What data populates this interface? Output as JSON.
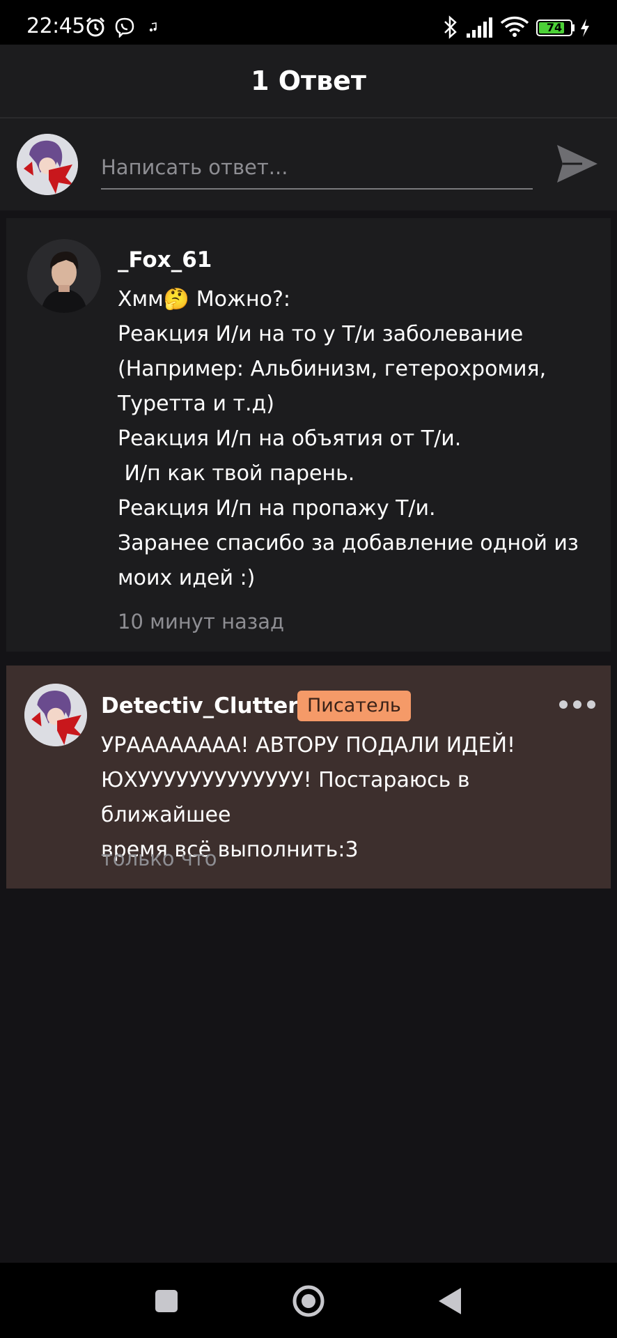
{
  "status_bar": {
    "time": "22:45",
    "battery_level": "74",
    "icons": [
      "alarm-icon",
      "viber-icon",
      "music-note-icon",
      "bluetooth-icon",
      "signal-icon",
      "wifi-icon",
      "battery-icon",
      "charging-icon"
    ]
  },
  "header": {
    "title": "1 Ответ"
  },
  "reply_box": {
    "placeholder": "Написать ответ...",
    "send_icon": "send-icon"
  },
  "comments": [
    {
      "author": "_Fox_61",
      "text": "Хмм🤔 Можно?:\nРеакция И/и на то у Т/и заболевание\n(Например: Альбинизм, гетерохромия,\nТуретта и т.д)\nРеакция И/п на объятия от Т/и.\n И/п как твой парень.\nРеакция И/п на пропажу Т/и.\nЗаранее спасибо за добавление одной из\nмоих идей :)",
      "time": "10 минут назад"
    },
    {
      "author": "Detectiv_Clutter",
      "badge": "Писатель",
      "text": "УРАААААААА! АВТОРУ ПОДАЛИ ИДЕЙ!\nЮХУУУУУУУУУУУУУ! Постараюсь в ближайшее\nвремя всё выполнить:3",
      "time": "только что",
      "menu_icon": "more-dots-icon"
    }
  ],
  "nav_bar": {
    "icons": [
      "recent-apps-icon",
      "home-icon",
      "back-icon"
    ]
  },
  "colors": {
    "background": "#141316",
    "card": "#1c1c1e",
    "highlight_card": "#3d2f2d",
    "badge": "#f59a68",
    "secondary_text": "#8e8e93",
    "battery_fill": "#4cd137"
  }
}
